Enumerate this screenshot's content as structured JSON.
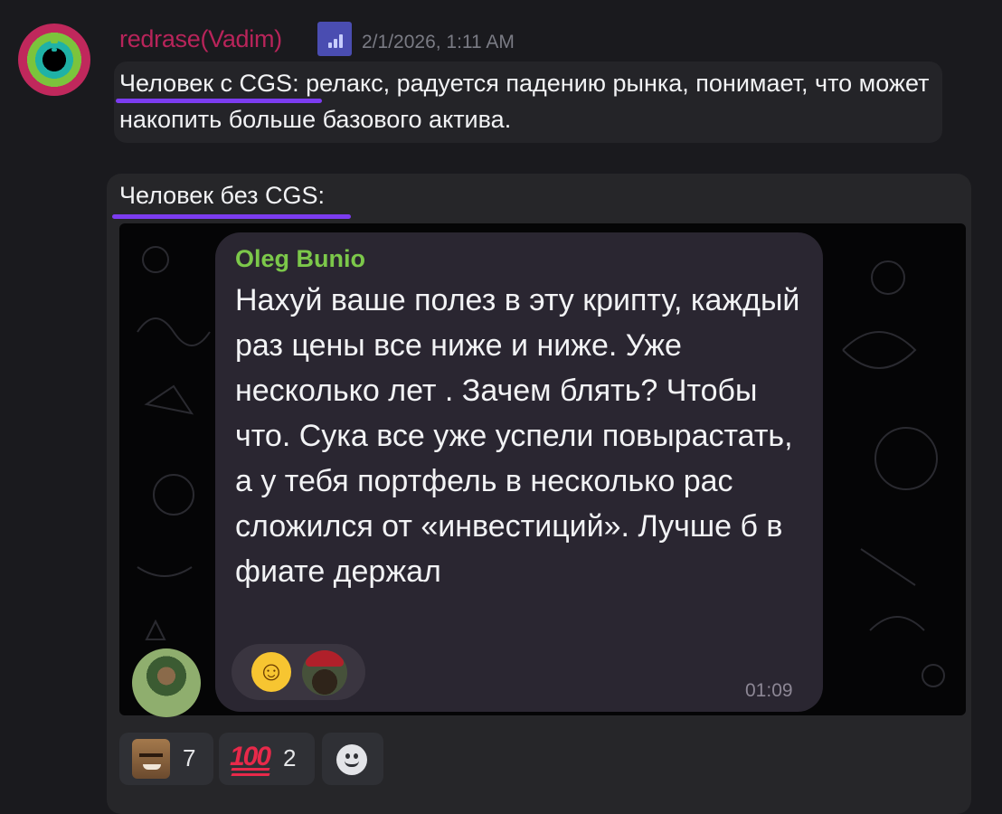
{
  "message": {
    "author": "redrase(Vadim)",
    "timestamp": "2/1/2026, 1:11 AM",
    "text": "Человек с CGS: релакс, радуется падению рынка, понимает, что может накопить больше базового актива.",
    "caption": "Человек без CGS:"
  },
  "embedded": {
    "sender": "Oleg Bunio",
    "text": "Нахуй ваше полез в эту крипту, каждый раз цены все ниже и ниже. Уже несколько лет . Зачем блять? Чтобы что. Сука все уже успели повырастать, а у тебя портфель в несколько рас сложился от «инвестиций». Лучше б в фиате держал",
    "time": "01:09",
    "reactions": [
      "laughing-rolling-icon",
      "user-avatar"
    ]
  },
  "reactions": [
    {
      "icon": "face-emoji-icon",
      "count": "7"
    },
    {
      "icon": "hundred-points-icon",
      "count": "2"
    }
  ],
  "add_reaction": "smile-icon",
  "colors": {
    "username": "#b8245a",
    "highlight": "#7c3cf0",
    "sender": "#7cc84a",
    "background": "#1a1a1e"
  }
}
